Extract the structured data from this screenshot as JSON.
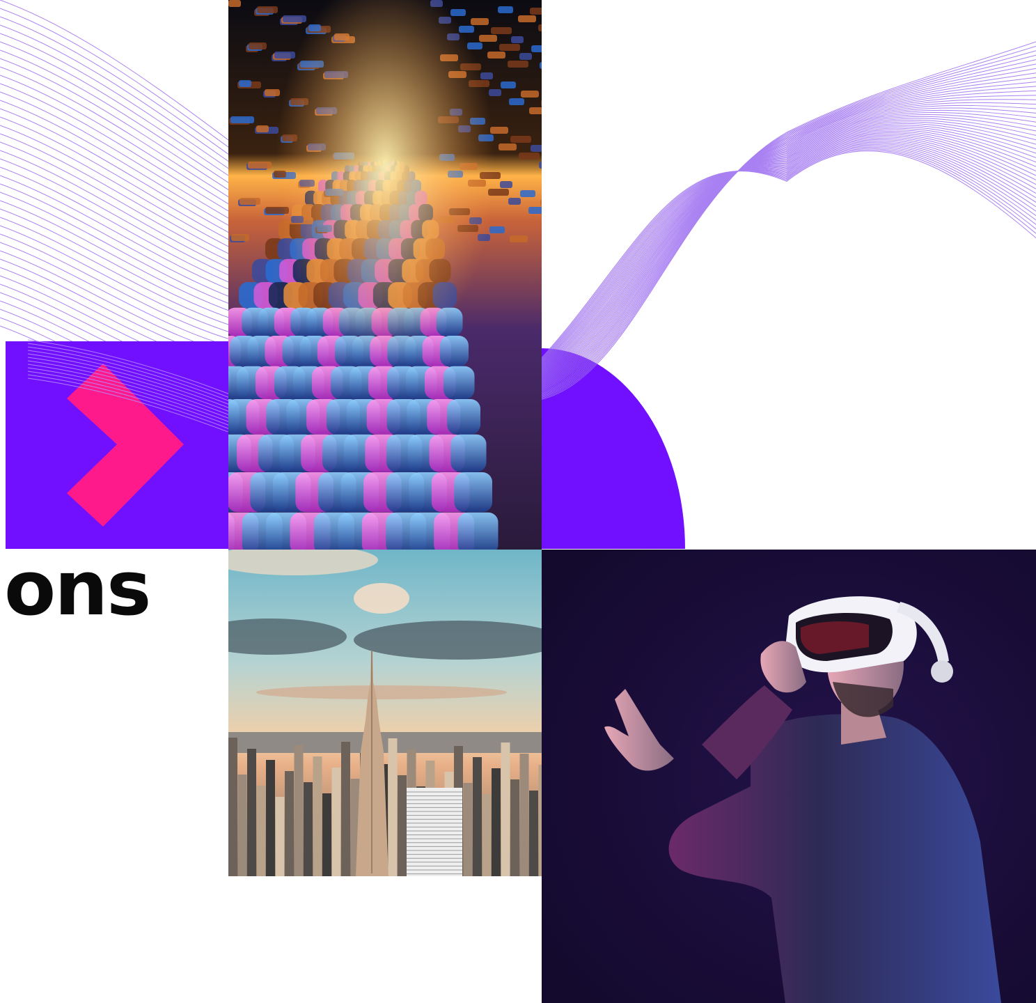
{
  "hero": {
    "heading_fragment": "ons"
  },
  "colors": {
    "brand_purple": "#7110ff",
    "accent_pink": "#ff1a8c",
    "wave_line": "#9b6cf0",
    "vr_background": "#1a0d38"
  },
  "images": {
    "tunnel": "abstract-glowing-tunnel-image",
    "city": "city-skyline-empire-state-image",
    "vr": "man-wearing-vr-headset-image"
  },
  "icons": {
    "chevron": "chevron-right-icon"
  }
}
